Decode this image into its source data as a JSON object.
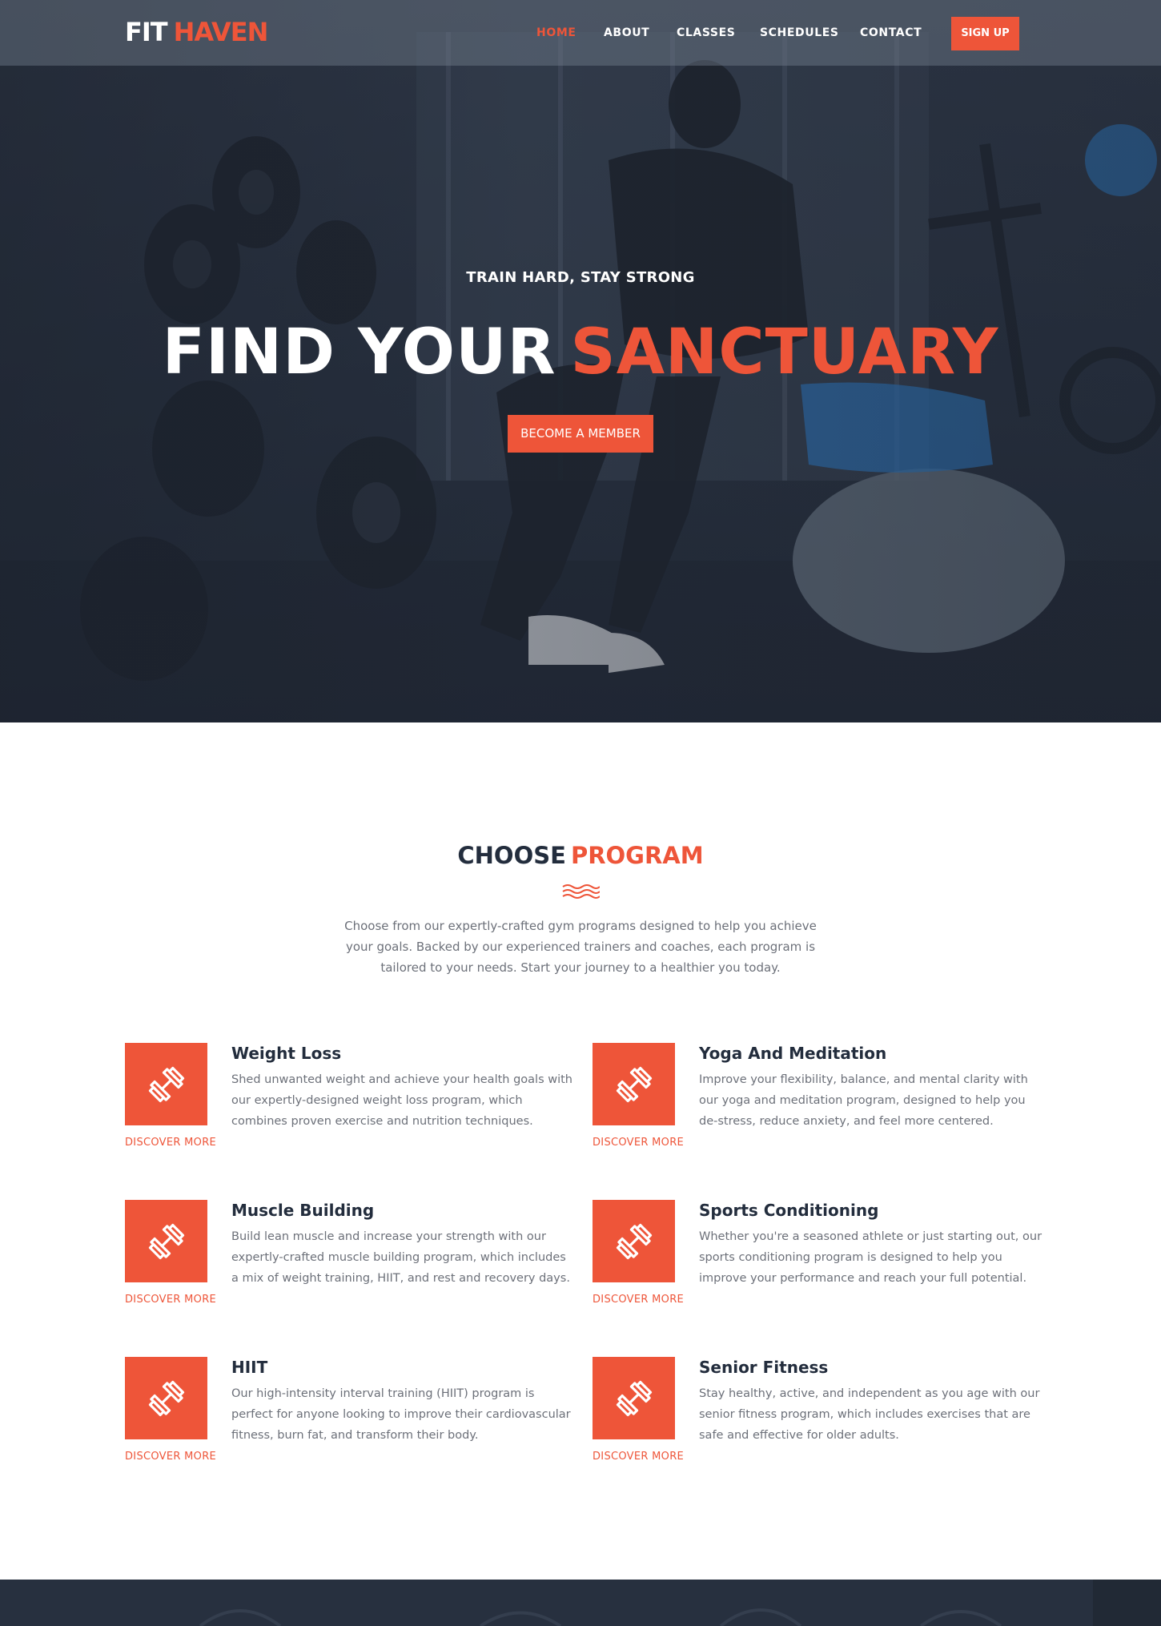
{
  "brand": {
    "part1": "FIT",
    "part2": "HAVEN"
  },
  "nav": {
    "items": [
      "HOME",
      "ABOUT",
      "CLASSES",
      "SCHEDULES",
      "CONTACT"
    ],
    "active": "HOME",
    "signup_label": "SIGN UP"
  },
  "hero": {
    "tagline": "TRAIN HARD, STAY STRONG",
    "headline_white": "FIND YOUR",
    "headline_accent": "SANCTUARY",
    "cta_label": "BECOME A MEMBER"
  },
  "programs": {
    "title_dark": "CHOOSE",
    "title_accent": "PROGRAM",
    "intro": "Choose from our expertly-crafted gym programs designed to help you achieve your goals. Backed by our experienced trainers and coaches, each program is tailored to your needs. Start your journey to a healthier you today.",
    "items": [
      {
        "title": "Weight Loss",
        "description": "Shed unwanted weight and achieve your health goals with our expertly-designed weight loss program, which combines proven exercise and nutrition techniques.",
        "link": "DISCOVER MORE",
        "icon": "dumbbell-icon"
      },
      {
        "title": "Yoga And Meditation",
        "description": "Improve your flexibility, balance, and mental clarity with our yoga and meditation program, designed to help you de-stress, reduce anxiety, and feel more centered.",
        "link": "DISCOVER MORE",
        "icon": "dumbbell-icon"
      },
      {
        "title": "Muscle Building",
        "description": "Build lean muscle and increase your strength with our expertly-crafted muscle building program, which includes a mix of weight training, HIIT, and rest and recovery days.",
        "link": "DISCOVER MORE",
        "icon": "dumbbell-icon"
      },
      {
        "title": "Sports Conditioning",
        "description": "Whether you're a seasoned athlete or just starting out, our sports conditioning program is designed to help you improve your performance and reach your full potential.",
        "link": "DISCOVER MORE",
        "icon": "dumbbell-icon"
      },
      {
        "title": "HIIT",
        "description": "Our high-intensity interval training (HIIT) program is perfect for anyone looking to improve their cardiovascular fitness, burn fat, and transform their body.",
        "link": "DISCOVER MORE",
        "icon": "dumbbell-icon"
      },
      {
        "title": "Senior Fitness",
        "description": "Stay healthy, active, and independent as you age with our senior fitness program, which includes exercises that are safe and effective for older adults.",
        "link": "DISCOVER MORE",
        "icon": "dumbbell-icon"
      }
    ]
  },
  "colors": {
    "accent": "#ee5539",
    "dark": "#232d3d",
    "muted_text": "#6c7079",
    "hero_bg": "#2a3343"
  }
}
